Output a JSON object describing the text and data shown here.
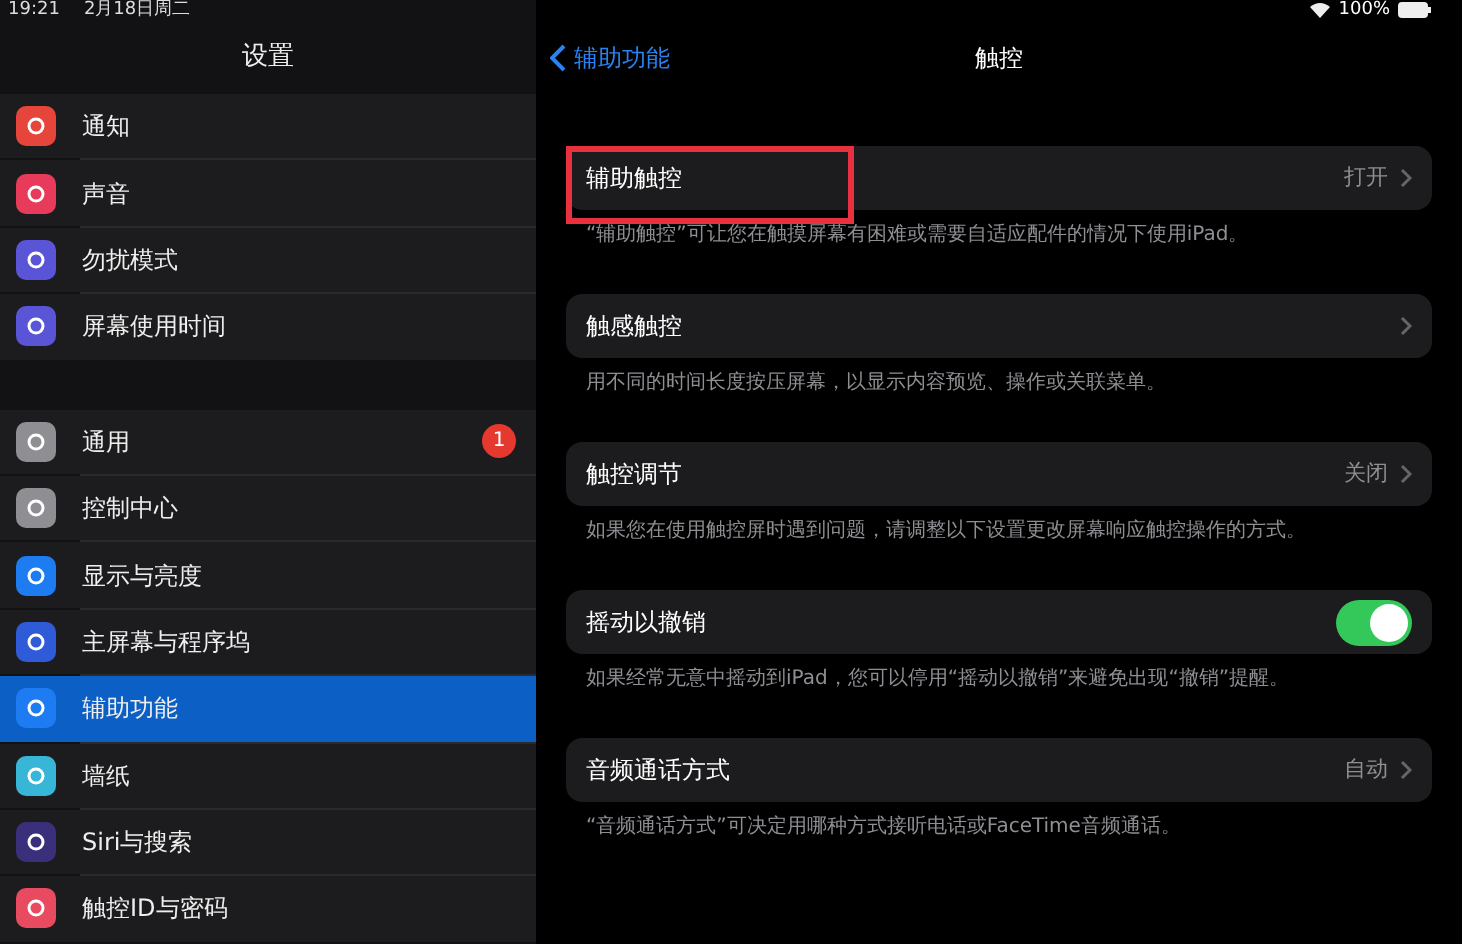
{
  "status_bar": {
    "time": "19:21",
    "date": "2月18日周二",
    "battery": "100%"
  },
  "sidebar": {
    "title": "设置",
    "groups": [
      {
        "items": [
          {
            "label": "通知",
            "color": "#e5453a",
            "selected": false
          },
          {
            "label": "声音",
            "color": "#e83a5a",
            "selected": false
          },
          {
            "label": "勿扰模式",
            "color": "#5a55d6",
            "selected": false
          },
          {
            "label": "屏幕使用时间",
            "color": "#5a55d6",
            "selected": false
          }
        ]
      },
      {
        "items": [
          {
            "label": "通用",
            "color": "#8e8e93",
            "selected": false,
            "badge": "1"
          },
          {
            "label": "控制中心",
            "color": "#8e8e93",
            "selected": false
          },
          {
            "label": "显示与亮度",
            "color": "#1d7cf2",
            "selected": false
          },
          {
            "label": "主屏幕与程序坞",
            "color": "#2f5bd8",
            "selected": false
          },
          {
            "label": "辅助功能",
            "color": "#1d7cf2",
            "selected": true
          },
          {
            "label": "墙纸",
            "color": "#38b6d8",
            "selected": false
          },
          {
            "label": "Siri与搜索",
            "color": "#3a2f7a",
            "selected": false
          },
          {
            "label": "触控ID与密码",
            "color": "#e84a5f",
            "selected": false
          }
        ]
      }
    ]
  },
  "detail": {
    "back": "辅助功能",
    "title": "触控",
    "sections": [
      {
        "kind": "link",
        "label": "辅助触控",
        "value": "打开",
        "highlighted": true,
        "footer": "“辅助触控”可让您在触摸屏幕有困难或需要自适应配件的情况下使用iPad。"
      },
      {
        "kind": "link",
        "label": "触感触控",
        "highlighted": false,
        "footer": "用不同的时间长度按压屏幕，以显示内容预览、操作或关联菜单。"
      },
      {
        "kind": "link",
        "label": "触控调节",
        "value": "关闭",
        "highlighted": false,
        "footer": "如果您在使用触控屏时遇到问题，请调整以下设置更改屏幕响应触控操作的方式。"
      },
      {
        "kind": "toggle",
        "label": "摇动以撤销",
        "on": true,
        "highlighted": false,
        "footer": "如果经常无意中摇动到iPad，您可以停用“摇动以撤销”来避免出现“撤销”提醒。"
      },
      {
        "kind": "link",
        "label": "音频通话方式",
        "value": "自动",
        "highlighted": false,
        "footer": "“音频通话方式”可决定用哪种方式接听电话或FaceTime音频通话。"
      }
    ]
  }
}
